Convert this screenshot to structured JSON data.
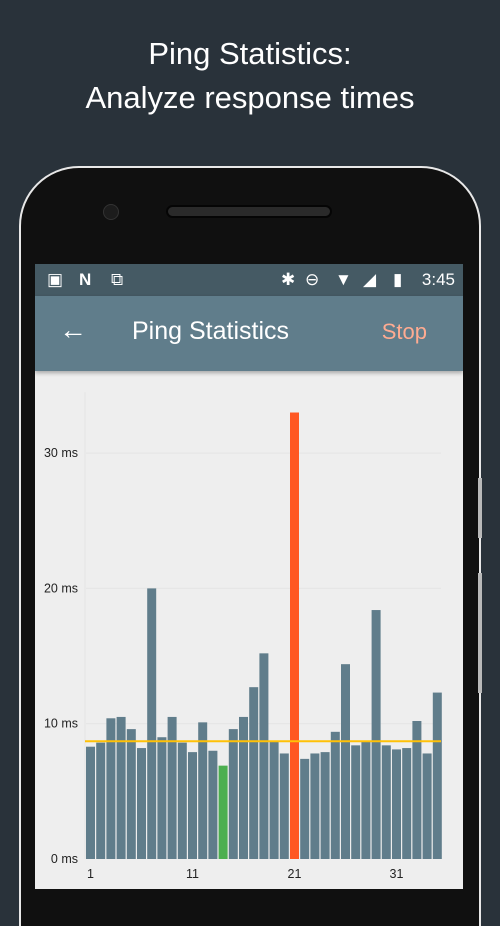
{
  "promo": {
    "line1": "Ping Statistics:",
    "line2": "Analyze response times"
  },
  "statusbar": {
    "left_icons": [
      "wifi-lock-icon",
      "nfc-n-icon",
      "work-briefcase-icon"
    ],
    "right_icons": [
      "bluetooth-icon",
      "do-not-disturb-icon",
      "wifi-icon",
      "cellular-signal-icon",
      "battery-charging-icon"
    ],
    "time": "3:45"
  },
  "appbar": {
    "back_icon": "arrow-back-icon",
    "title": "Ping Statistics",
    "action": "Stop"
  },
  "colors": {
    "bar": "#607d8b",
    "min_bar": "#4caf50",
    "max_bar": "#ff5722",
    "average_line": "#ffc107",
    "appbar": "#607d8b",
    "statusbar": "#455a64",
    "action": "#ffab91"
  },
  "chart_data": {
    "type": "bar",
    "title": "",
    "xlabel": "",
    "ylabel": "",
    "x_ticks": [
      "1",
      "11",
      "21",
      "31"
    ],
    "y_ticks": [
      "0 ms",
      "10 ms",
      "20 ms",
      "30 ms"
    ],
    "ylim": [
      0,
      34.5
    ],
    "grid": true,
    "categories": [
      1,
      2,
      3,
      4,
      5,
      6,
      7,
      8,
      9,
      10,
      11,
      12,
      13,
      14,
      15,
      16,
      17,
      18,
      19,
      20,
      21,
      22,
      23,
      24,
      25,
      26,
      27,
      28,
      29,
      30,
      31,
      32,
      33,
      34,
      35
    ],
    "values": [
      8.3,
      8.6,
      10.4,
      10.5,
      9.6,
      8.2,
      20.0,
      9.0,
      10.5,
      8.6,
      7.9,
      10.1,
      8.0,
      6.9,
      9.6,
      10.5,
      12.7,
      15.2,
      8.7,
      7.8,
      33.0,
      7.4,
      7.8,
      7.9,
      9.4,
      14.4,
      8.4,
      8.7,
      18.4,
      8.4,
      8.1,
      8.2,
      10.2,
      7.8,
      12.3
    ],
    "min_index": 14,
    "max_index": 21,
    "average": 8.7,
    "unit": "ms"
  }
}
